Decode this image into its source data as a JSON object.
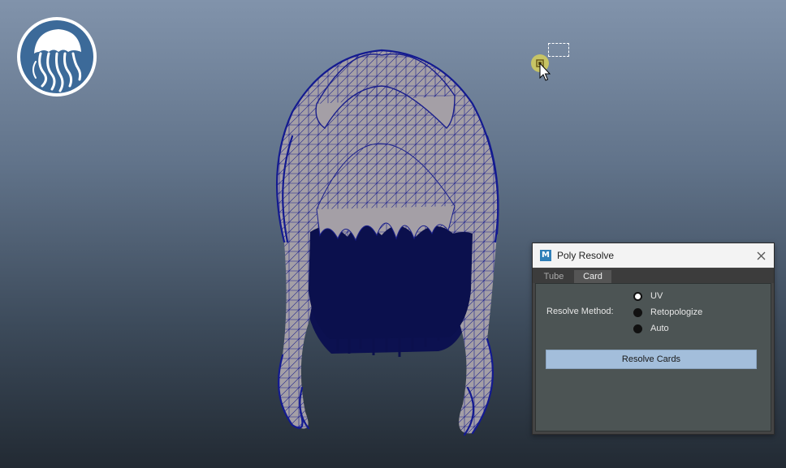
{
  "window": {
    "title": "Poly Resolve",
    "app_icon_letter": "M",
    "close_icon": "close-icon"
  },
  "tabs": [
    {
      "label": "Tube",
      "active": false
    },
    {
      "label": "Card",
      "active": true
    }
  ],
  "card_panel": {
    "method_label": "Resolve Method:",
    "options": [
      {
        "label": "UV",
        "selected": true
      },
      {
        "label": "Retopologize",
        "selected": false
      },
      {
        "label": "Auto",
        "selected": false
      }
    ],
    "resolve_button_label": "Resolve Cards"
  },
  "viewport": {
    "logo": "jellyfish-logo",
    "model": "hair-mesh-wireframe",
    "cursor_icon": "select-cursor-icon"
  },
  "colors": {
    "button_accent": "#a3bedb",
    "wireframe": "#0f1a8a",
    "hair_fill": "#a49fa6"
  }
}
